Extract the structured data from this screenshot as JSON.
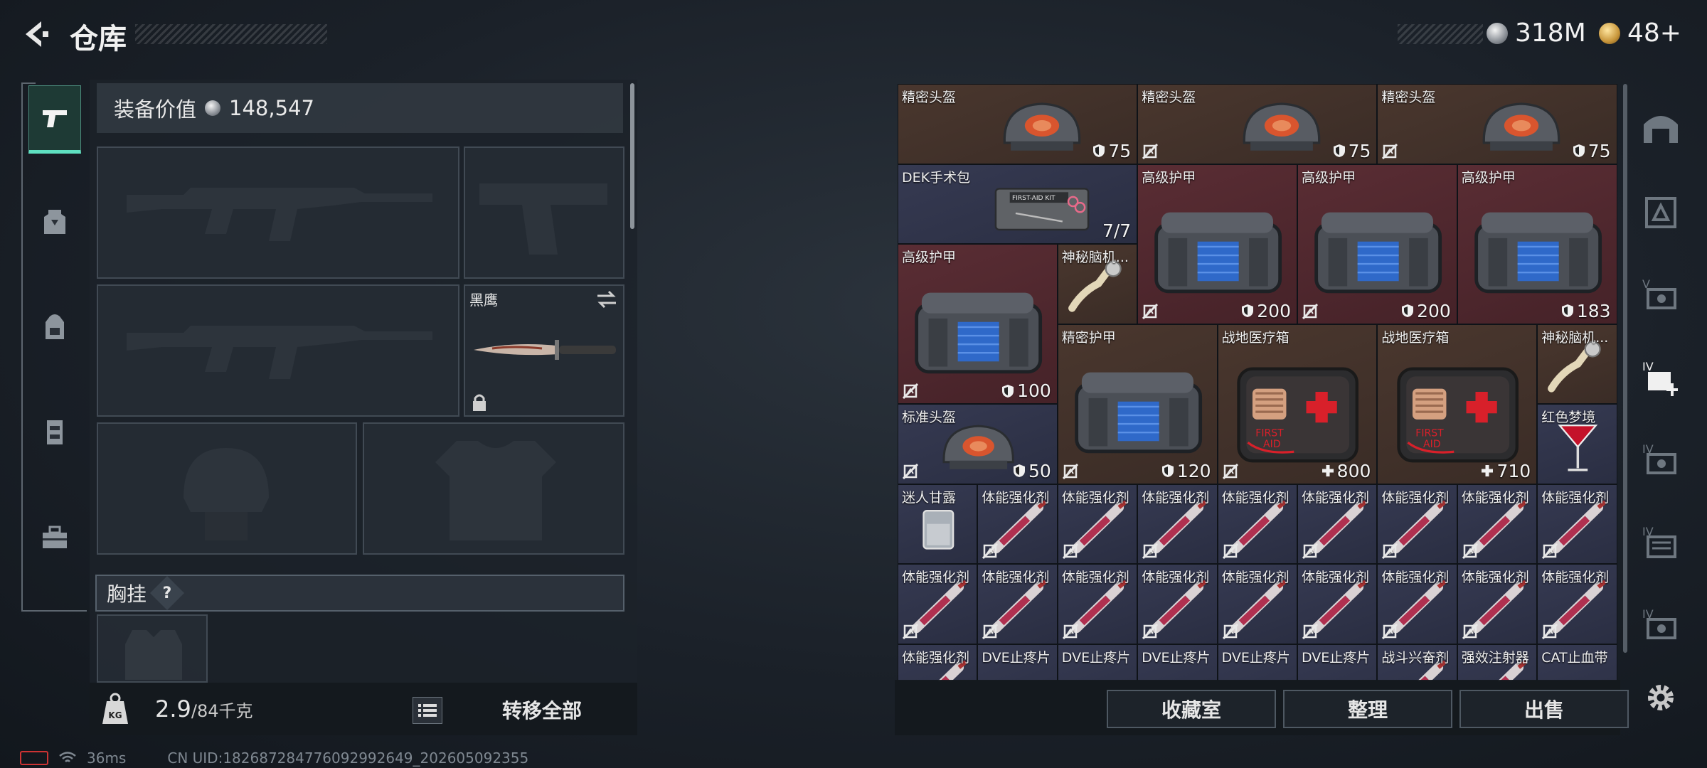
{
  "header": {
    "title": "仓库",
    "currency_silver": "318M",
    "currency_gold": "48+"
  },
  "left_nav": [
    {
      "icon": "pistol-icon",
      "active": true
    },
    {
      "icon": "chest-rig-icon",
      "active": false
    },
    {
      "icon": "backpack-icon",
      "active": false
    },
    {
      "icon": "pouch-icon",
      "active": false
    },
    {
      "icon": "toolbox-icon",
      "active": false
    }
  ],
  "equipment": {
    "value_label": "装备价值",
    "value": "148,547",
    "knife_name": "黑鹰",
    "chest_label": "胸挂",
    "chest_help": "?",
    "weight": "2.9",
    "weight_max": "/84千克",
    "transfer_all": "转移全部"
  },
  "grid_items": [
    {
      "name": "精密头盔",
      "value": "75",
      "icon": "shield-icon",
      "color": "brown",
      "art": "helmet"
    },
    {
      "name": "精密头盔",
      "value": "75",
      "icon": "shield-icon",
      "color": "brown",
      "art": "helmet",
      "nosell": true
    },
    {
      "name": "精密头盔",
      "value": "75",
      "icon": "shield-icon",
      "color": "brown",
      "art": "helmet",
      "nosell": true
    },
    {
      "name": "DEK手术包",
      "value": "7/7",
      "icon": "",
      "color": "blue",
      "art": "kit"
    },
    {
      "name": "高级护甲",
      "value": "200",
      "icon": "shield-icon",
      "color": "red",
      "art": "armor",
      "nosell": true
    },
    {
      "name": "高级护甲",
      "value": "200",
      "icon": "shield-icon",
      "color": "red",
      "art": "armor",
      "nosell": true
    },
    {
      "name": "高级护甲",
      "value": "183",
      "icon": "shield-icon",
      "color": "red",
      "art": "armor"
    },
    {
      "name": "高级护甲",
      "value": "100",
      "icon": "shield-icon",
      "color": "red",
      "art": "armor",
      "nosell": true
    },
    {
      "name": "神秘脑机...",
      "value": "",
      "icon": "",
      "color": "brown",
      "art": "device"
    },
    {
      "name": "精密护甲",
      "value": "120",
      "icon": "shield-icon",
      "color": "brown",
      "art": "armor",
      "nosell": true
    },
    {
      "name": "战地医疗箱",
      "value": "800",
      "icon": "plus-icon",
      "color": "brown",
      "art": "medkit",
      "nosell": true
    },
    {
      "name": "战地医疗箱",
      "value": "710",
      "icon": "plus-icon",
      "color": "brown",
      "art": "medkit"
    },
    {
      "name": "神秘脑机...",
      "value": "",
      "icon": "",
      "color": "brown",
      "art": "device"
    },
    {
      "name": "标准头盔",
      "value": "50",
      "icon": "shield-icon",
      "color": "blue",
      "art": "helmet",
      "nosell": true
    },
    {
      "name": "红色梦境",
      "value": "",
      "icon": "",
      "color": "blue",
      "art": "cocktail"
    },
    {
      "name": "迷人甘露",
      "value": "",
      "icon": "",
      "color": "blue",
      "art": "glass"
    },
    {
      "name": "体能强化剂",
      "color": "blue",
      "art": "injector",
      "nosell": true
    },
    {
      "name": "体能强化剂",
      "color": "blue",
      "art": "injector",
      "nosell": true
    },
    {
      "name": "体能强化剂",
      "color": "blue",
      "art": "injector",
      "nosell": true
    },
    {
      "name": "体能强化剂",
      "color": "blue",
      "art": "injector",
      "nosell": true
    },
    {
      "name": "体能强化剂",
      "color": "blue",
      "art": "injector",
      "nosell": true
    },
    {
      "name": "体能强化剂",
      "color": "blue",
      "art": "injector",
      "nosell": true
    },
    {
      "name": "体能强化剂",
      "color": "blue",
      "art": "injector",
      "nosell": true
    },
    {
      "name": "体能强化剂",
      "color": "blue",
      "art": "injector",
      "nosell": true
    },
    {
      "name": "体能强化剂",
      "color": "blue",
      "art": "injector",
      "nosell": true
    },
    {
      "name": "体能强化剂",
      "color": "blue",
      "art": "injector",
      "nosell": true
    },
    {
      "name": "体能强化剂",
      "color": "blue",
      "art": "injector",
      "nosell": true
    },
    {
      "name": "体能强化剂",
      "color": "blue",
      "art": "injector",
      "nosell": true
    },
    {
      "name": "体能强化剂",
      "color": "blue",
      "art": "injector",
      "nosell": true
    },
    {
      "name": "体能强化剂",
      "color": "blue",
      "art": "injector",
      "nosell": true
    },
    {
      "name": "体能强化剂",
      "color": "blue",
      "art": "injector",
      "nosell": true
    },
    {
      "name": "体能强化剂",
      "color": "blue",
      "art": "injector",
      "nosell": true
    },
    {
      "name": "体能强化剂",
      "color": "blue",
      "art": "injector",
      "nosell": true
    },
    {
      "name": "体能强化剂",
      "color": "blue",
      "art": "injector"
    },
    {
      "name": "DVE止疼片",
      "color": "blue",
      "art": "pills"
    },
    {
      "name": "DVE止疼片",
      "color": "blue",
      "art": "pills"
    },
    {
      "name": "DVE止疼片",
      "color": "blue",
      "art": "pills"
    },
    {
      "name": "DVE止疼片",
      "color": "blue",
      "art": "pills"
    },
    {
      "name": "DVE止疼片",
      "color": "blue",
      "art": "pills"
    },
    {
      "name": "战斗兴奋剂",
      "color": "blue",
      "art": "injector"
    },
    {
      "name": "强效注射器",
      "color": "blue",
      "art": "injector"
    },
    {
      "name": "CAT止血带",
      "color": "blue",
      "art": "pills"
    }
  ],
  "right_buttons": {
    "collection": "收藏室",
    "organize": "整理",
    "sell": "出售"
  },
  "right_nav": [
    "helmet-slot-icon",
    "chest-slot-icon",
    "case-v-icon",
    "case-iv-plus-icon",
    "case-iv-a-icon",
    "case-iv-b-icon",
    "case-iv-c-icon",
    "settings-icon"
  ],
  "status": {
    "ping": "36ms",
    "uid": "CN UID:1826872847760929926​49_202605092355"
  }
}
